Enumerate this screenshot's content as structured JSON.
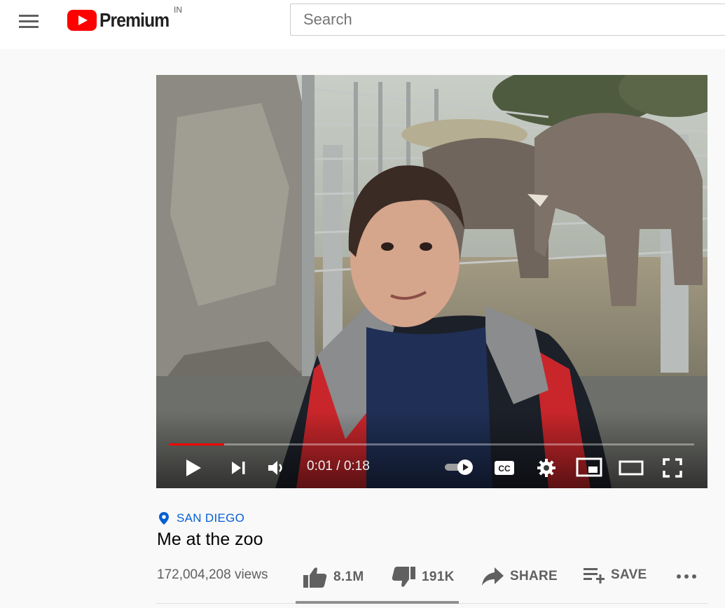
{
  "header": {
    "logo_text": "Premium",
    "country_code": "IN",
    "search_placeholder": "Search"
  },
  "player": {
    "current_time": "0:01",
    "duration": "0:18",
    "time_display": "0:01 / 0:18",
    "progress_fraction": 0.105,
    "autoplay": true
  },
  "video": {
    "location": "SAN DIEGO",
    "title": "Me at the zoo",
    "views": "172,004,208 views"
  },
  "actions": {
    "like_count": "8.1M",
    "dislike_count": "191K",
    "share_label": "SHARE",
    "save_label": "SAVE"
  },
  "colors": {
    "brand_red": "#ff0000",
    "link_blue": "#065fd4",
    "secondary_text": "#606060"
  }
}
